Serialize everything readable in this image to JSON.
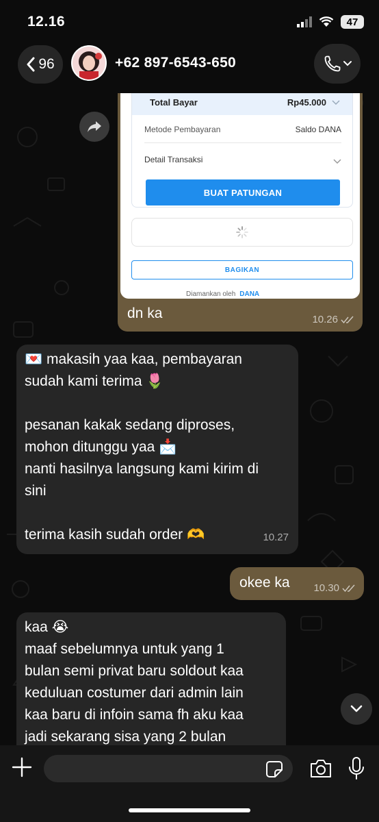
{
  "status_bar": {
    "time": "12.16",
    "battery": "47"
  },
  "header": {
    "back_count": "96",
    "contact_name": "+62 897-6543-650"
  },
  "payment_card": {
    "total_label": "Total Bayar",
    "total_value": "Rp45.000",
    "method_label": "Metode Pembayaran",
    "method_value": "Saldo DANA",
    "detail_label": "Detail Transaksi",
    "create_button": "BUAT PATUNGAN",
    "share_button": "BAGIKAN",
    "secured_by": "Diamankan oleh",
    "secured_brand": "DANA"
  },
  "messages": [
    {
      "id": "m1",
      "direction": "out",
      "text": "dn ka",
      "time": "10.26"
    },
    {
      "id": "m2",
      "direction": "in",
      "lines": [
        "💌 makasih yaa kaa, pembayaran",
        "sudah kami terima 🌷",
        "",
        "pesanan kakak sedang diproses,",
        "mohon ditunggu yaa 📩",
        "nanti hasilnya langsung kami kirim di",
        "sini",
        "",
        "terima kasih sudah order 🫶"
      ],
      "time": "10.27"
    },
    {
      "id": "m3",
      "direction": "out",
      "text": "okee ka",
      "time": "10.30"
    },
    {
      "id": "m4",
      "direction": "in",
      "lines": [
        "kaa 😭",
        "maaf sebelumnya untuk yang 1",
        "bulan semi privat baru soldout kaa",
        "keduluan costumer dari admin lain",
        "kaa baru di infoin sama fh aku kaa",
        "jadi sekarang sisa yang 2 bulan"
      ]
    }
  ],
  "composer": {
    "value": "",
    "placeholder": ""
  },
  "icons": {
    "back": "chevron-left-icon",
    "call": "phone-icon",
    "forward": "forward-arrow-icon",
    "scroll": "chevron-down-icon",
    "plus": "plus-icon",
    "sticker": "sticker-icon",
    "camera": "camera-icon",
    "mic": "microphone-icon"
  },
  "colors": {
    "outgoing_bubble": "#6b5a3d",
    "incoming_bubble": "#262626",
    "dana_blue": "#1f8ded",
    "background": "#0c0c0c"
  }
}
